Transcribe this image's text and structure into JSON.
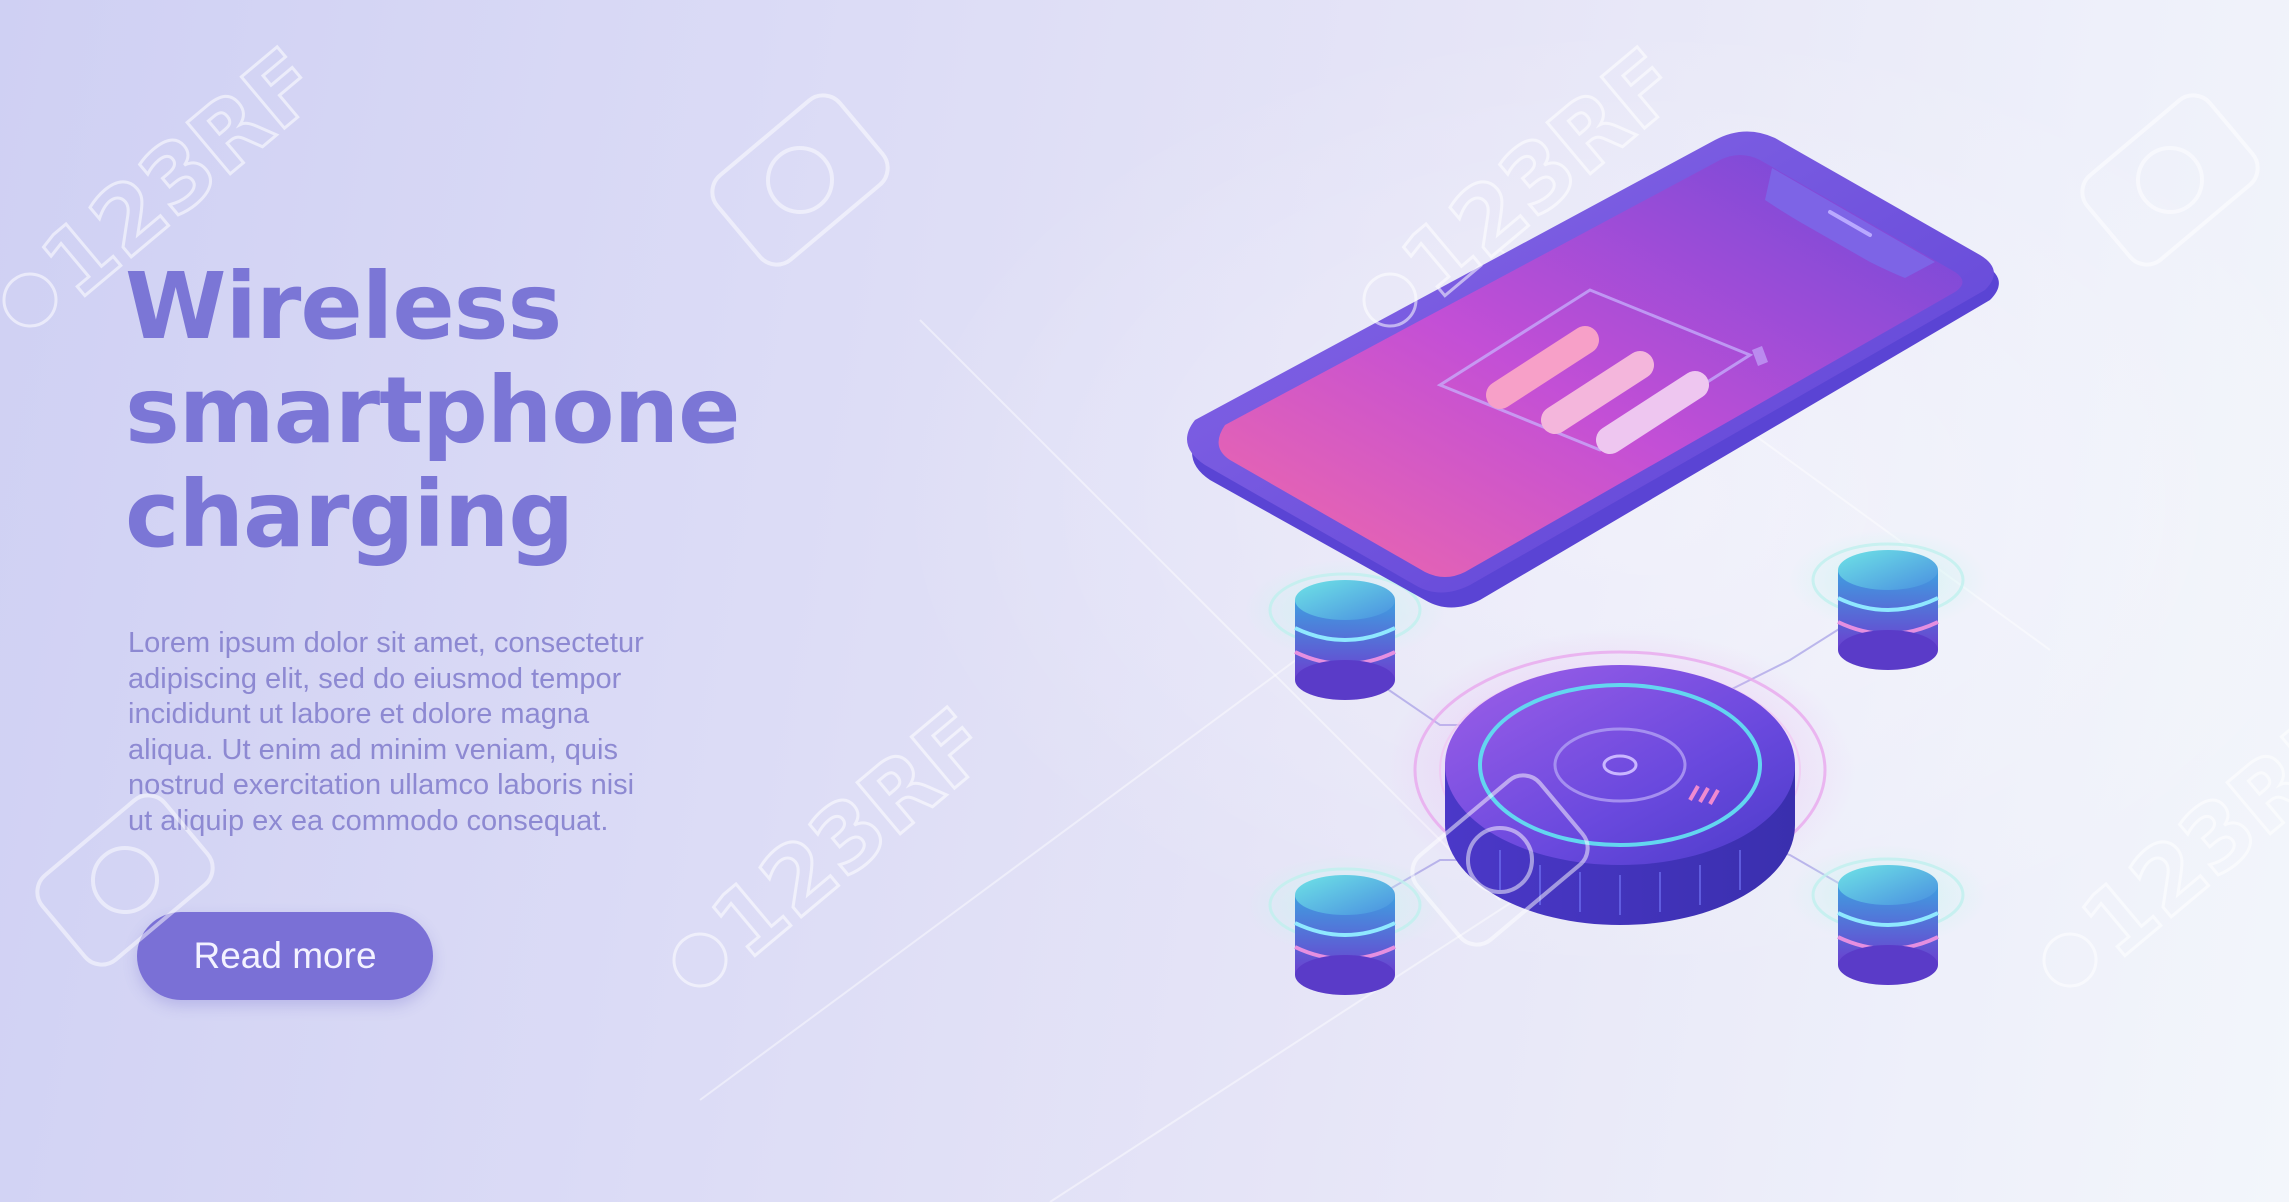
{
  "hero": {
    "title_lines": [
      "Wireless",
      "smartphone",
      "charging"
    ],
    "body_lines": [
      "Lorem ipsum dolor sit amet, consectetur",
      "adipiscing elit, sed do eiusmod tempor",
      "incididunt ut labore et dolore magna",
      "aliqua. Ut enim ad minim veniam, quis",
      "nostrud exercitation ullamco laboris nisi",
      "ut aliquip ex ea commodo consequat."
    ],
    "button_label": "Read more"
  },
  "illustration": {
    "phone_icon": "smartphone-icon",
    "battery_icon": "battery-charging-icon",
    "charger_icon": "wireless-charging-pad-icon",
    "database_icon": "database-stack-icon",
    "battery_level_bars": 3
  },
  "watermark": {
    "text": "123RF",
    "icon": "camera-icon"
  },
  "colors": {
    "accent": "#7a70d6",
    "title": "#7b76d6",
    "body": "#8d89d2",
    "background": "#dcdcf6"
  }
}
